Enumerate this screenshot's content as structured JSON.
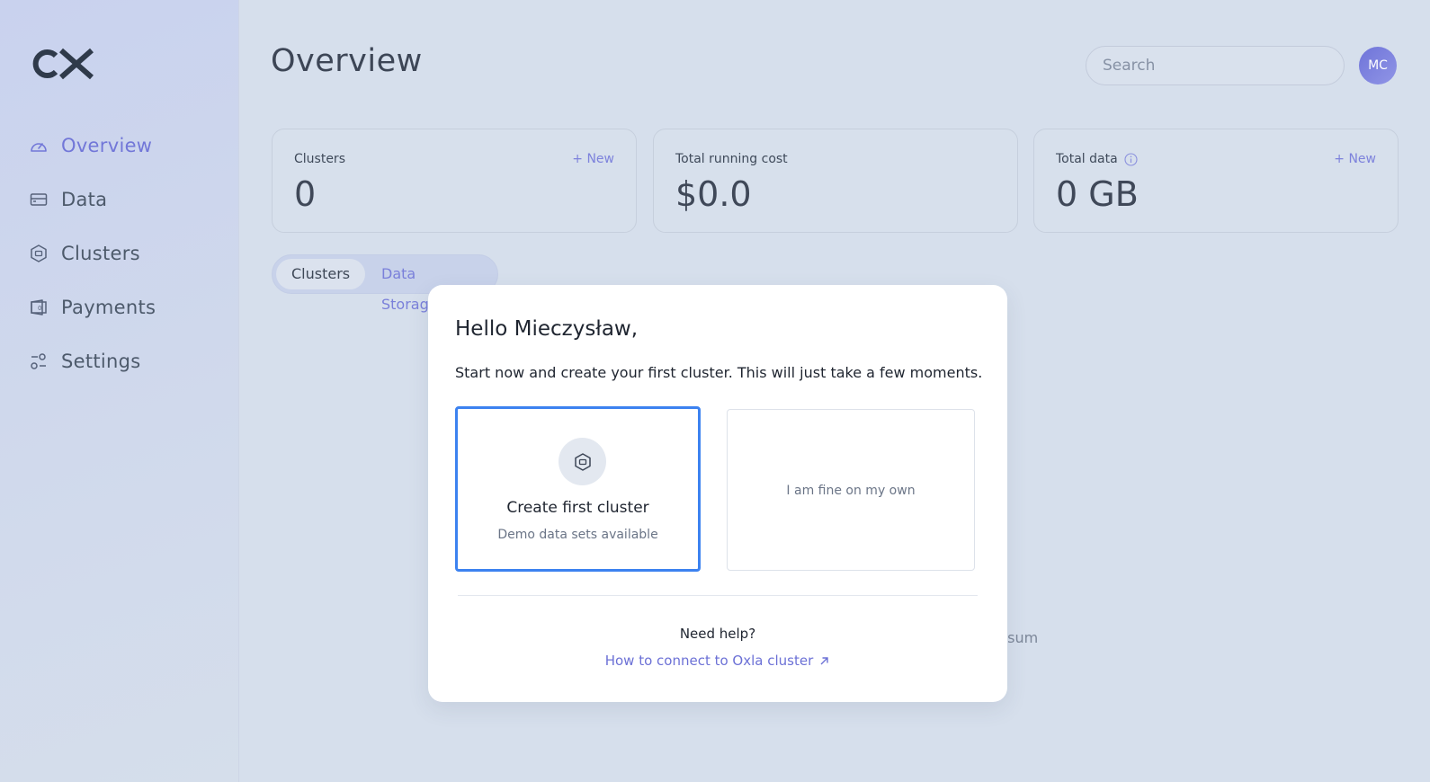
{
  "app": {
    "logo_text": "OX"
  },
  "sidebar": {
    "items": [
      {
        "label": "Overview",
        "icon": "gauge-icon",
        "active": true
      },
      {
        "label": "Data",
        "icon": "server-icon",
        "active": false
      },
      {
        "label": "Clusters",
        "icon": "hexagon-cluster-icon",
        "active": false
      },
      {
        "label": "Payments",
        "icon": "wallet-icon",
        "active": false
      },
      {
        "label": "Settings",
        "icon": "sliders-icon",
        "active": false
      }
    ]
  },
  "header": {
    "title": "Overview",
    "search_placeholder": "Search",
    "avatar_initials": "MC"
  },
  "stats": [
    {
      "label": "Clusters",
      "value": "0",
      "action": "+ New"
    },
    {
      "label": "Total running cost",
      "value": "$0.0"
    },
    {
      "label": "Total data",
      "value": "0 GB",
      "action": "+ New",
      "info_icon": "info-icon"
    }
  ],
  "tabs": [
    {
      "label": "Clusters",
      "selected": true
    },
    {
      "label": "Data Storages",
      "selected": false
    }
  ],
  "background_text": "psum",
  "modal": {
    "title": "Hello Mieczysław,",
    "text": "Start now and create your first cluster. This will just take a few moments.",
    "option_primary": {
      "title": "Create first cluster",
      "subtitle": "Demo data sets available",
      "icon": "hexagon-cluster-icon"
    },
    "option_secondary": {
      "label": "I am fine on my own"
    },
    "help_title": "Need help?",
    "help_link": "How to connect to Oxla cluster"
  },
  "colors": {
    "accent": "#7277d8",
    "focus_border": "#3c82f0",
    "background": "#d6dfec"
  }
}
